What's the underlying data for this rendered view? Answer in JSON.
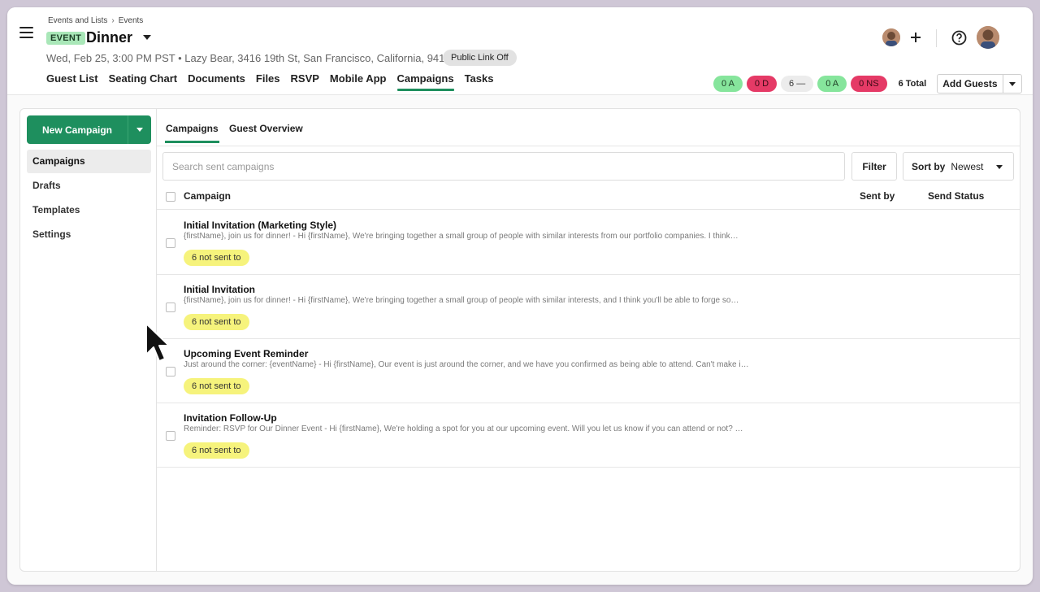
{
  "header": {
    "breadcrumb": [
      "Events and Lists",
      "Events"
    ],
    "breadcrumb_sep": "›",
    "badge": "EVENT",
    "title": "Dinner",
    "details": "Wed, Feb 25, 3:00 PM PST • Lazy Bear, 3416 19th St, San Francisco, California, 94110",
    "public_link": "Public Link Off",
    "tabs": [
      {
        "label": "Guest List"
      },
      {
        "label": "Seating Chart"
      },
      {
        "label": "Documents"
      },
      {
        "label": "Files"
      },
      {
        "label": "RSVP"
      },
      {
        "label": "Mobile App"
      },
      {
        "label": "Campaigns",
        "active": true
      },
      {
        "label": "Tasks"
      }
    ],
    "status": [
      {
        "label": "0 A",
        "color": "green"
      },
      {
        "label": "0 D",
        "color": "red"
      },
      {
        "label": "6 —",
        "color": "gray"
      },
      {
        "label": "0 A",
        "color": "green"
      },
      {
        "label": "0 NS",
        "color": "red"
      }
    ],
    "total": "6 Total",
    "add_guests": "Add Guests"
  },
  "sidebar": {
    "new_campaign": "New Campaign",
    "items": [
      {
        "label": "Campaigns",
        "active": true
      },
      {
        "label": "Drafts"
      },
      {
        "label": "Templates"
      },
      {
        "label": "Settings"
      }
    ]
  },
  "main": {
    "subtabs": [
      "Campaigns",
      "Guest Overview"
    ],
    "search_placeholder": "Search sent campaigns",
    "filter": "Filter",
    "sort_label": "Sort by",
    "sort_value": "Newest",
    "columns": [
      "Campaign",
      "Sent by",
      "Send Status"
    ],
    "rows": [
      {
        "title": "Initial Invitation (Marketing Style)",
        "preview": "{firstName}, join us for dinner! - Hi {firstName}, We're bringing together a small group of people with similar interests from our portfolio companies. I think…",
        "badge": "6 not sent to"
      },
      {
        "title": "Initial Invitation",
        "preview": "{firstName}, join us for dinner! - Hi {firstName}, We're bringing together a small group of people with similar interests, and I think you'll be able to forge so…",
        "badge": "6 not sent to"
      },
      {
        "title": "Upcoming Event Reminder",
        "preview": "Just around the corner: {eventName} - Hi {firstName}, Our event is just around the corner, and we have you confirmed as being able to attend. Can't make i…",
        "badge": "6 not sent to"
      },
      {
        "title": "Invitation Follow-Up",
        "preview": "Reminder: RSVP for Our Dinner Event - Hi {firstName},   We're holding a spot for you at our upcoming event. Will you let us know if you can attend or not? …",
        "badge": "6 not sent to"
      }
    ]
  },
  "colors": {
    "accent": "#1e8f5e",
    "badge_yellow": "#f6f37c",
    "pill_green": "#86e59c",
    "pill_red": "#e53a66"
  }
}
